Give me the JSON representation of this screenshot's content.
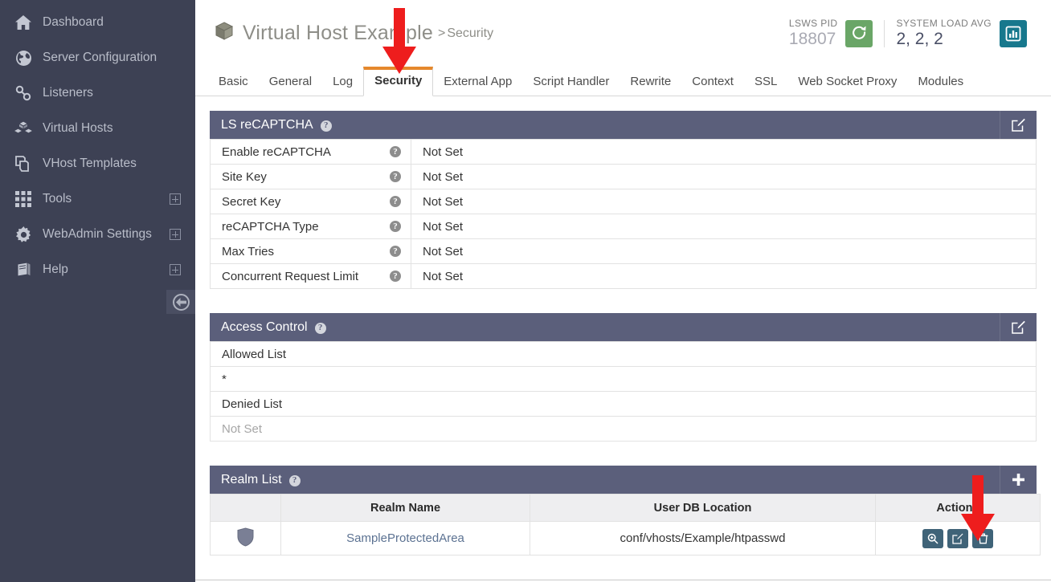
{
  "sidebar": {
    "items": [
      {
        "label": "Dashboard",
        "icon": "home-icon",
        "expandable": false
      },
      {
        "label": "Server Configuration",
        "icon": "globe-icon",
        "expandable": false
      },
      {
        "label": "Listeners",
        "icon": "link-icon",
        "expandable": false
      },
      {
        "label": "Virtual Hosts",
        "icon": "boxes-icon",
        "expandable": false
      },
      {
        "label": "VHost Templates",
        "icon": "copy-icon",
        "expandable": false
      },
      {
        "label": "Tools",
        "icon": "grid-icon",
        "expandable": true
      },
      {
        "label": "WebAdmin Settings",
        "icon": "gear-icon",
        "expandable": true
      },
      {
        "label": "Help",
        "icon": "book-icon",
        "expandable": true
      }
    ],
    "collapse_icon": "arrow-left-circle-icon"
  },
  "header": {
    "icon": "cube-icon",
    "title": "Virtual Host Example",
    "separator": ">",
    "subtitle": "Security",
    "stats": [
      {
        "label": "LSWS PID",
        "value": "18807",
        "icon": "refresh-icon",
        "color": "#6aa667"
      },
      {
        "label": "SYSTEM LOAD AVG",
        "value": "2, 2, 2",
        "icon": "chart-bar-icon",
        "color": "#17788d"
      }
    ]
  },
  "tabs": {
    "active": "Security",
    "items": [
      {
        "label": "Basic"
      },
      {
        "label": "General"
      },
      {
        "label": "Log"
      },
      {
        "label": "Security"
      },
      {
        "label": "External App"
      },
      {
        "label": "Script Handler"
      },
      {
        "label": "Rewrite"
      },
      {
        "label": "Context"
      },
      {
        "label": "SSL"
      },
      {
        "label": "Web Socket Proxy"
      },
      {
        "label": "Modules"
      }
    ]
  },
  "panels": {
    "recaptcha": {
      "title": "LS reCAPTCHA",
      "help": "?",
      "edit_icon": "edit-icon",
      "rows": [
        {
          "label": "Enable reCAPTCHA",
          "help": "?",
          "value": "Not Set"
        },
        {
          "label": "Site Key",
          "help": "?",
          "value": "Not Set"
        },
        {
          "label": "Secret Key",
          "help": "?",
          "value": "Not Set"
        },
        {
          "label": "reCAPTCHA Type",
          "help": "?",
          "value": "Not Set"
        },
        {
          "label": "Max Tries",
          "help": "?",
          "value": "Not Set"
        },
        {
          "label": "Concurrent Request Limit",
          "help": "?",
          "value": "Not Set"
        }
      ]
    },
    "access_control": {
      "title": "Access Control",
      "help": "?",
      "edit_icon": "edit-icon",
      "allowed_label": "Allowed List",
      "allowed_value": "*",
      "denied_label": "Denied List",
      "denied_value": "Not Set"
    },
    "realm_list": {
      "title": "Realm List",
      "help": "?",
      "add_icon": "plus-icon",
      "columns": [
        "",
        "Realm Name",
        "User DB Location",
        "Actions"
      ],
      "rows": [
        {
          "icon": "shield-icon",
          "realm_name": "SampleProtectedArea",
          "user_db_location": "conf/vhosts/Example/htpasswd",
          "actions": [
            "view-icon",
            "edit-icon",
            "delete-icon"
          ]
        }
      ]
    }
  },
  "annotations": {
    "arrow_color": "#ee1d1d",
    "arrow_security_target": "Security",
    "arrow_delete_target": "delete-icon"
  }
}
